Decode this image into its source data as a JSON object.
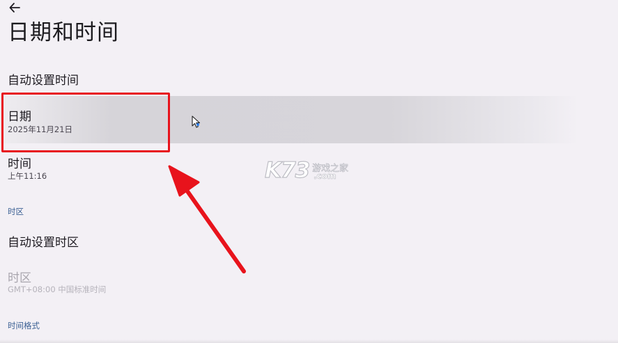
{
  "header": {
    "title": "日期和时间"
  },
  "settings": {
    "auto_time": {
      "title": "自动设置时间"
    },
    "date": {
      "title": "日期",
      "value": "2025年11月21日"
    },
    "time": {
      "title": "时间",
      "value": "上午11:16"
    },
    "timezone_section": {
      "header": "时区"
    },
    "auto_timezone": {
      "title": "自动设置时区"
    },
    "timezone": {
      "title": "时区",
      "value": "GMT+08:00 中国标准时间"
    },
    "time_format_section": {
      "header": "时间格式"
    }
  },
  "watermark": {
    "logo": "K73",
    "text": "游戏之家",
    "domain": ".com"
  },
  "colors": {
    "background": "#f3f0f5",
    "section_header": "#3a5f93",
    "annotation_red": "#e8131c",
    "selected_row": "#d6d4d9"
  },
  "icons": {
    "back": "arrow-left-icon",
    "cursor": "mouse-pointer-icon"
  }
}
